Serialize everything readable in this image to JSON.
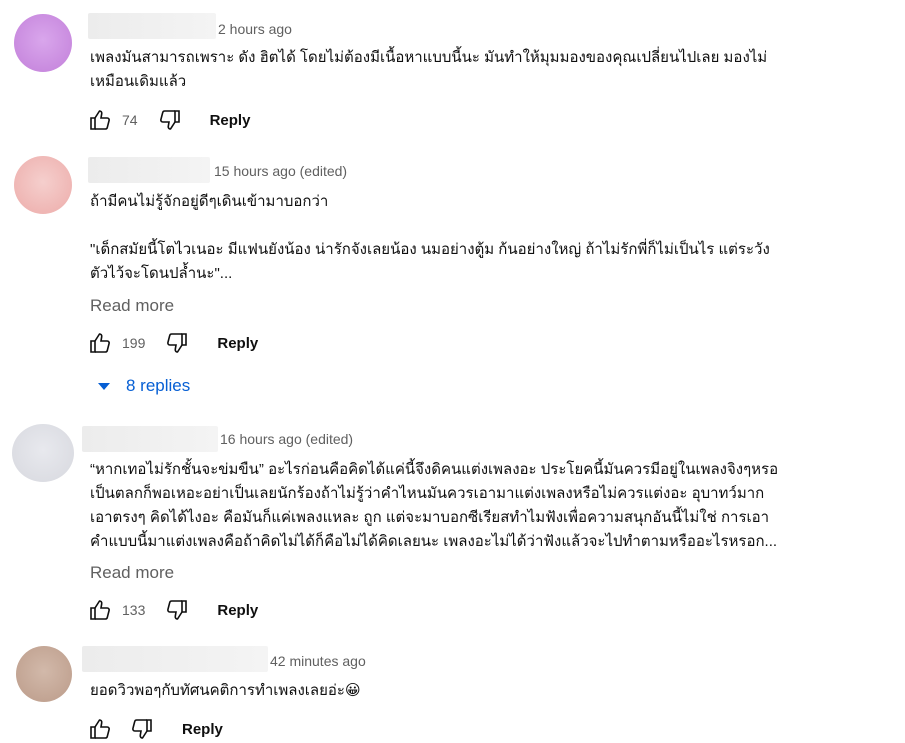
{
  "colors": {
    "link": "#065fd4",
    "muted": "#606060",
    "text": "#0f0f0f"
  },
  "comments": [
    {
      "timestamp": "2 hours ago",
      "text": "เพลงมันสามารถเพราะ ดัง ฮิตได้ โดยไม่ต้องมีเนื้อหาแบบนี้นะ มันทำให้มุมมองของคุณเปลี่ยนไปเลย มองไม่\nเหมือนเดิมแล้ว",
      "likes": "74",
      "reply_label": "Reply",
      "avatar_color": "#c98bdf"
    },
    {
      "timestamp": "15 hours ago (edited)",
      "text": "ถ้ามีคนไม่รู้จักอยู่ดีๆเดินเข้ามาบอกว่า\n\n\"เด็กสมัยนี้โตไวเนอะ มีแฟนยังน้อง น่ารักจังเลยน้อง นมอย่างตู้ม ก้นอย่างใหญ่ ถ้าไม่รักพี่ก็ไม่เป็นไร แต่ระวัง\nตัวไว้จะโดนปล้ำนะ\"...",
      "read_more": "Read more",
      "likes": "199",
      "reply_label": "Reply",
      "replies_label": "8 replies",
      "avatar_color": "#efb6b4"
    },
    {
      "timestamp": "16 hours ago (edited)",
      "text": "“หากเทอไม่รักชั้นจะข่มขืน” อะไรก่อนคือคิดได้แค่นี้จึงดิคนแต่งเพลงอะ ประโยคนี้มันควรมีอยู่ในเพลงจิงๆหรอ\nเป็นตลกก็พอเหอะอย่าเป็นเลยนักร้องถ้าไม่รู้ว่าคำไหนมันควรเอามาแต่งเพลงหรือไม่ควรแต่งอะ อุบาทว์มาก\nเอาตรงๆ คิดได้ไงอะ คือมันก็แค่เพลงแหละ ถูก แต่จะมาบอกซีเรียสทำไมฟังเพื่อความสนุกอันนี้ไม่ใช่ การเอา\nคำแบบนี้มาแต่งเพลงคือถ้าคิดไม่ได้ก็คือไม่ได้คิดเลยนะ เพลงอะไม่ได้ว่าฟังแล้วจะไปทำตามหรืออะไรหรอก...",
      "read_more": "Read more",
      "likes": "133",
      "reply_label": "Reply",
      "avatar_color": "#dcdde3"
    },
    {
      "timestamp": "42 minutes ago",
      "text": "ยอดวิวพอๆกับทัศนคติการทำเพลงเลยอ่ะ😀",
      "likes": "",
      "reply_label": "Reply",
      "avatar_color": "#c2a493"
    }
  ]
}
